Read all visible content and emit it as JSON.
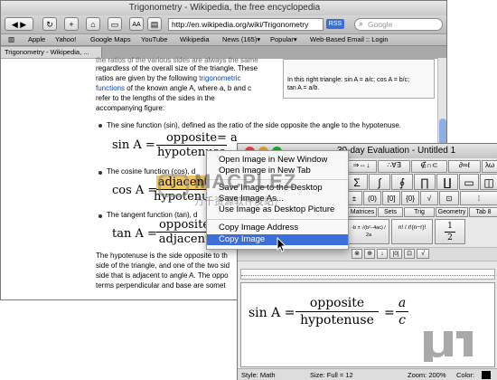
{
  "safari": {
    "title": "Trigonometry - Wikipedia, the free encyclopedia",
    "url": "http://en.wikipedia.org/wiki/Trigonometry",
    "rss": "RSS",
    "search_placeholder": "Google",
    "bookmarks": [
      "Apple",
      "Yahoo!",
      "Google Maps",
      "YouTube",
      "Wikipedia",
      "News (165)▾",
      "Popular▾",
      "Web-Based Email :: Login"
    ],
    "tab_label": "Trigonometry - Wikipedia, ..."
  },
  "article": {
    "intro_line0": "the ratios of the various sides are always the same",
    "intro_line1": "regardless of the overall size of the triangle. These",
    "intro_line2a": "ratios are given by the following ",
    "intro_link1": "trigonometric",
    "intro_link2": "functions",
    "intro_line3b": " of the known angle A, where a, b and c",
    "intro_line4": "refer to the lengths of the sides in the",
    "intro_line5": "accompanying figure:",
    "sine_text_b": "sine",
    "sine_text": "The sine function (sin), defined as the ratio of the side opposite the angle to the hypotenuse.",
    "sine_lhs": "sin A =",
    "sine_num": "opposite",
    "sine_den": "hypotenuse",
    "sine_rhs": "= a",
    "cosine_text": "The cosine function (cos), d",
    "cos_lhs": "cos A =",
    "cos_num": "adjacent",
    "cos_den": "hypotenuse",
    "tangent_text": "The tangent function (tan), d",
    "tan_lhs": "tan A =",
    "tan_num": "opposite",
    "tan_den": "adjacent",
    "para1": "The hypotenuse is the side opposite to th",
    "para2": "side of the triangle, and one of the two sid",
    "para3": "side that is adjacent to angle A. The oppo",
    "para4": "terms perpendicular and base are somet"
  },
  "infobox": {
    "caption1": "In this right triangle: sin A = a/c; cos A = b/c;",
    "caption2": "tan A = a/b."
  },
  "context_menu": {
    "items": [
      "Open Image in New Window",
      "Open Image in New Tab",
      "Save Image to the Desktop",
      "Save Image As...",
      "Use Image as Desktop Picture",
      "Copy Image Address",
      "Copy Image"
    ],
    "selected_index": 6
  },
  "mathmagic": {
    "title": "30-day Evaluation - Untitled 1",
    "palette_row1": [
      "≤≠≈",
      "⇒⇔↓",
      "∴∀∃",
      "∉∩⊂",
      "∂∞ℓ",
      "λω"
    ],
    "palette_row2": [
      "Σ",
      "∫",
      "∮",
      "∏",
      "∐",
      "▭",
      "◫",
      "▯"
    ],
    "palette_row3": [
      "±",
      "(0)",
      "[0]",
      "{0}",
      "√",
      "⊡",
      "⁞"
    ],
    "tabs": [
      "Matrices",
      "Sets",
      "Trig",
      "Geometry",
      "Tab 8"
    ],
    "template_quad": "-b ± √(b²−4ac) / 2a",
    "template_perm": "n! / r!(n−r)!",
    "template_half_num": "1",
    "template_half_den": "2",
    "canvas_lhs": "sin A =",
    "canvas_num": "opposite",
    "canvas_den": "hypotenuse",
    "canvas_rhs_eq": "=",
    "canvas_rhs_num": "a",
    "canvas_rhs_den": "c",
    "status_style": "Style: Math",
    "status_size": "Size: Full = 12",
    "status_zoom": "Zoom: 200%",
    "status_color": "Color:"
  },
  "watermark": {
    "brand": "MACPLEZ",
    "site": "万千资源软件发站！"
  },
  "colors": {
    "link": "#0645ad",
    "menu_highlight": "#3b6ed9",
    "traffic_red": "#e0443e",
    "traffic_yellow": "#dea123",
    "traffic_green": "#1aab29"
  }
}
